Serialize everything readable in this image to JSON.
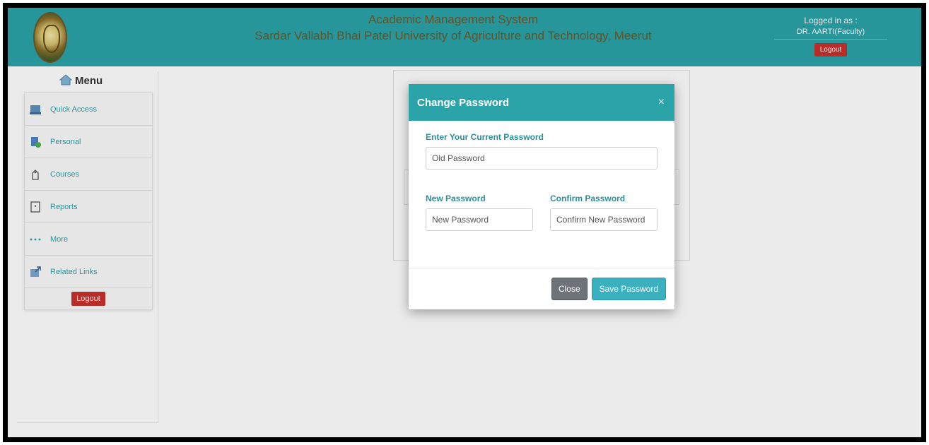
{
  "header": {
    "title_line1": "Academic Management System",
    "title_line2": "Sardar Vallabh Bhai Patel University of Agriculture and Technology, Meerut",
    "logged_in_label": "Logged in as :",
    "user_name": "DR. AARTI(Faculty)",
    "logout_label": "Logout"
  },
  "sidebar": {
    "menu_title": "Menu",
    "items": [
      {
        "label": "Quick Access",
        "icon": "quick-access-icon"
      },
      {
        "label": "Personal",
        "icon": "personal-icon"
      },
      {
        "label": "Courses",
        "icon": "courses-icon"
      },
      {
        "label": "Reports",
        "icon": "reports-icon"
      },
      {
        "label": "More",
        "icon": "more-icon"
      },
      {
        "label": "Related Links",
        "icon": "related-links-icon"
      }
    ],
    "logout_label": "Logout"
  },
  "modal": {
    "title": "Change Password",
    "close_glyph": "×",
    "current_password_label": "Enter Your Current Password",
    "current_password_placeholder": "Old Password",
    "new_password_label": "New Password",
    "new_password_placeholder": "New Password",
    "confirm_password_label": "Confirm Password",
    "confirm_password_placeholder": "Confirm New Password",
    "close_button": "Close",
    "save_button": "Save Password"
  },
  "colors": {
    "accent": "#2aa3a9",
    "danger": "#c9302c",
    "save": "#3bb1c0"
  }
}
